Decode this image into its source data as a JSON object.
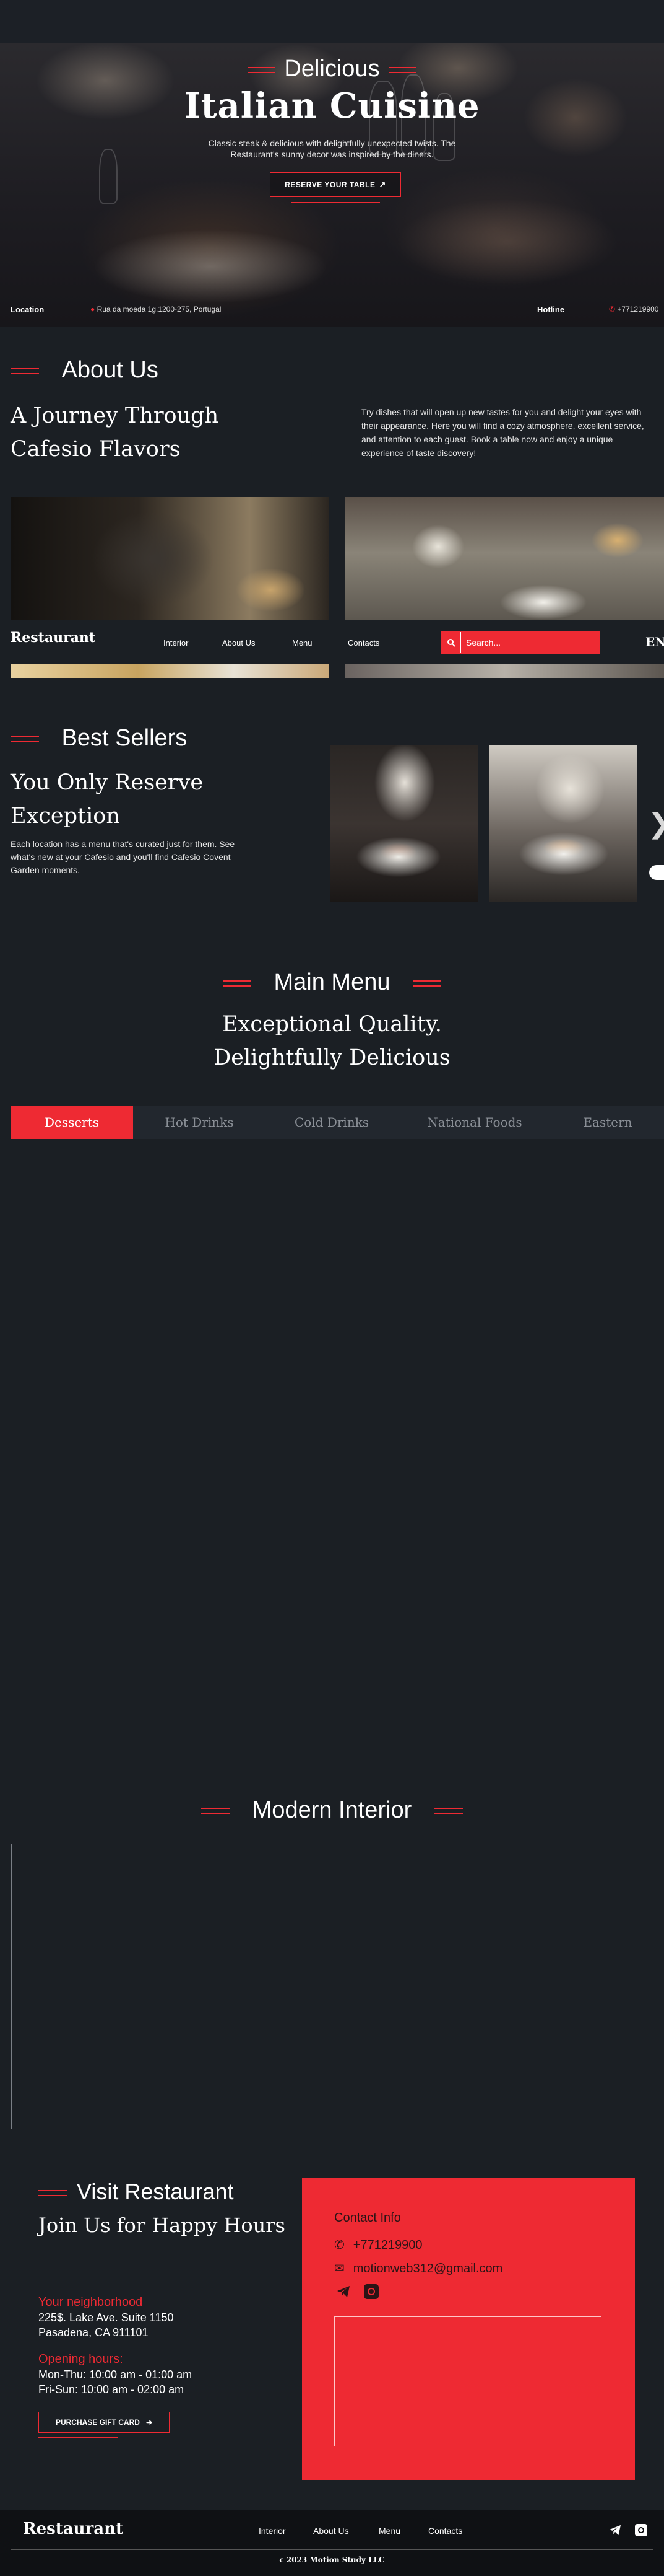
{
  "hero": {
    "kicker": "Delicious",
    "title": "Italian Cuisine",
    "description": "Classic steak & delicious with delightfully unexpected twists. The Restaurant's sunny decor was inspired by the diners.",
    "cta": "RESERVE YOUR TABLE",
    "location_label": "Location",
    "location_value": "Rua da moeda 1g,1200-275, Portugal",
    "hotline_label": "Hotline",
    "hotline_value": "+771219900"
  },
  "about": {
    "heading": "About Us",
    "title_line1": "A Journey Through",
    "title_line2": "Cafesio Flavors",
    "text": "Try dishes that will open up new tastes for you and delight your eyes with their appearance. Here you will find a cozy atmosphere, excellent service, and attention to each guest. Book a table now and enjoy a unique experience of taste discovery!"
  },
  "nav": {
    "logo": "Restaurant",
    "links": [
      "Interior",
      "About Us",
      "Menu",
      "Contacts"
    ],
    "search_placeholder": "Search...",
    "lang": "EN"
  },
  "best": {
    "heading": "Best Sellers",
    "title_line1": "You Only Reserve",
    "title_line2": "Exception",
    "text": "Each location has a menu that's curated just for them. See what's new at your Cafesio and you'll find Cafesio Covent Garden moments."
  },
  "menu": {
    "heading": "Main Menu",
    "sub_line1": "Exceptional Quality.",
    "sub_line2": "Delightfully Delicious",
    "tabs": [
      "Desserts",
      "Hot Drinks",
      "Cold Drinks",
      "National Foods",
      "Eastern"
    ],
    "active_tab": "Desserts"
  },
  "interior": {
    "heading": "Modern Interior"
  },
  "visit": {
    "heading": "Visit Restaurant",
    "title": "Join Us for Happy Hours",
    "neighborhood_label": "Your neighborhood",
    "address_line1": "225$. Lake Ave. Suite 1150",
    "address_line2": "Pasadena, CA 911101",
    "hours_label": "Opening hours:",
    "hours_line1": "Mon-Thu: 10:00 am - 01:00 am",
    "hours_line2": "Fri-Sun: 10:00 am - 02:00 am",
    "gift_cta": "PURCHASE GIFT CARD"
  },
  "contact": {
    "title": "Contact Info",
    "phone": "+771219900",
    "email": "motionweb312@gmail.com"
  },
  "footer": {
    "logo": "Restaurant",
    "links": [
      "Interior",
      "About Us",
      "Menu",
      "Contacts"
    ],
    "copyright": "c 2023 Motion Study LLC"
  },
  "colors": {
    "accent": "#ee2a33",
    "background": "#1b1f24",
    "footer": "#0f1114"
  },
  "icons": [
    "map-pin-icon",
    "phone-icon",
    "arrow-right-icon",
    "search-icon",
    "chevron-right-icon",
    "mail-icon",
    "telegram-icon",
    "instagram-icon"
  ]
}
